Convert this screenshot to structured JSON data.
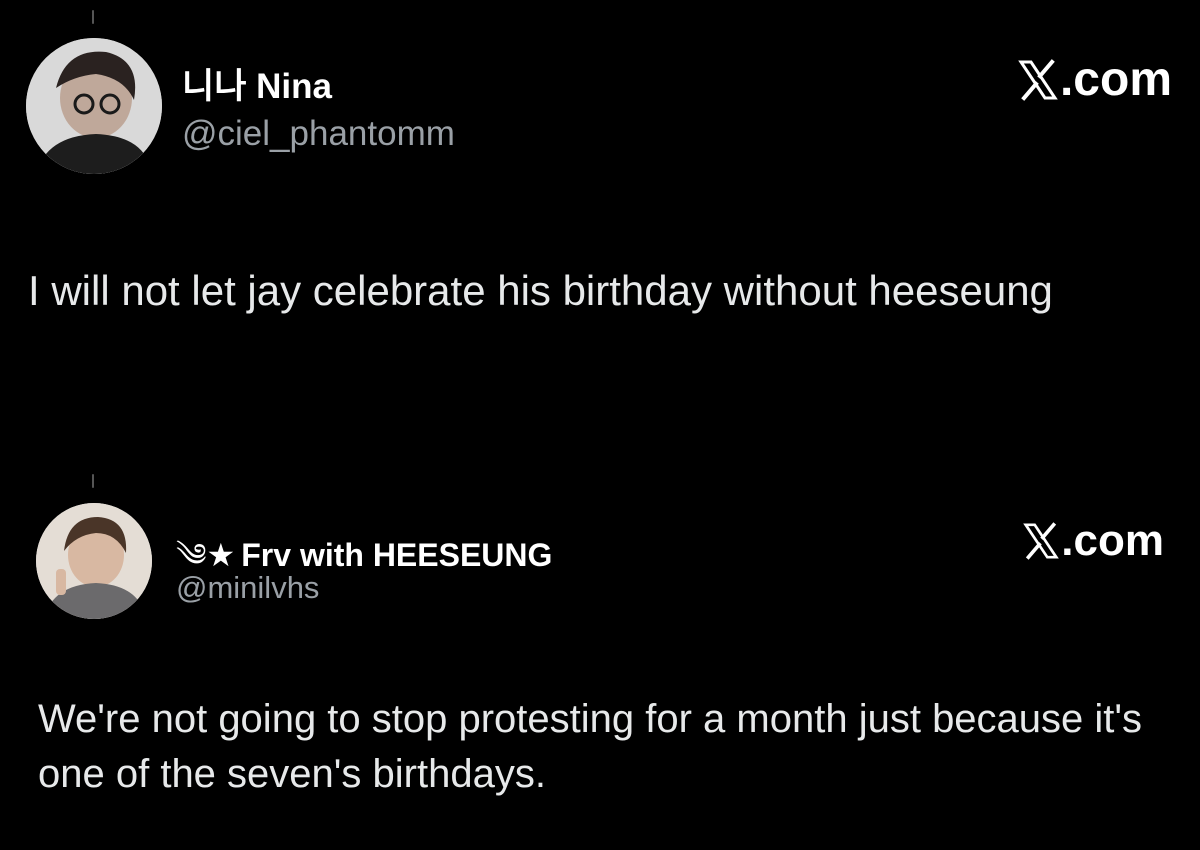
{
  "posts": [
    {
      "display_name": "니나 Nina",
      "handle": "@ciel_phantomm",
      "brand": ".com",
      "text": "I will not let jay celebrate his birthday without heeseung"
    },
    {
      "name_prefix": "༄★",
      "display_name": "Frv with HEESEUNG",
      "handle": "@minilvhs",
      "brand": ".com",
      "text": "We're not going to stop protesting for a month just because it's one of the seven's birthdays."
    }
  ],
  "colors": {
    "background": "#000000",
    "name": "#ffffff",
    "handle": "#9aa0a6",
    "body_text": "#e7e9ea"
  },
  "icons": {
    "brand_mark": "x-logo-icon"
  }
}
